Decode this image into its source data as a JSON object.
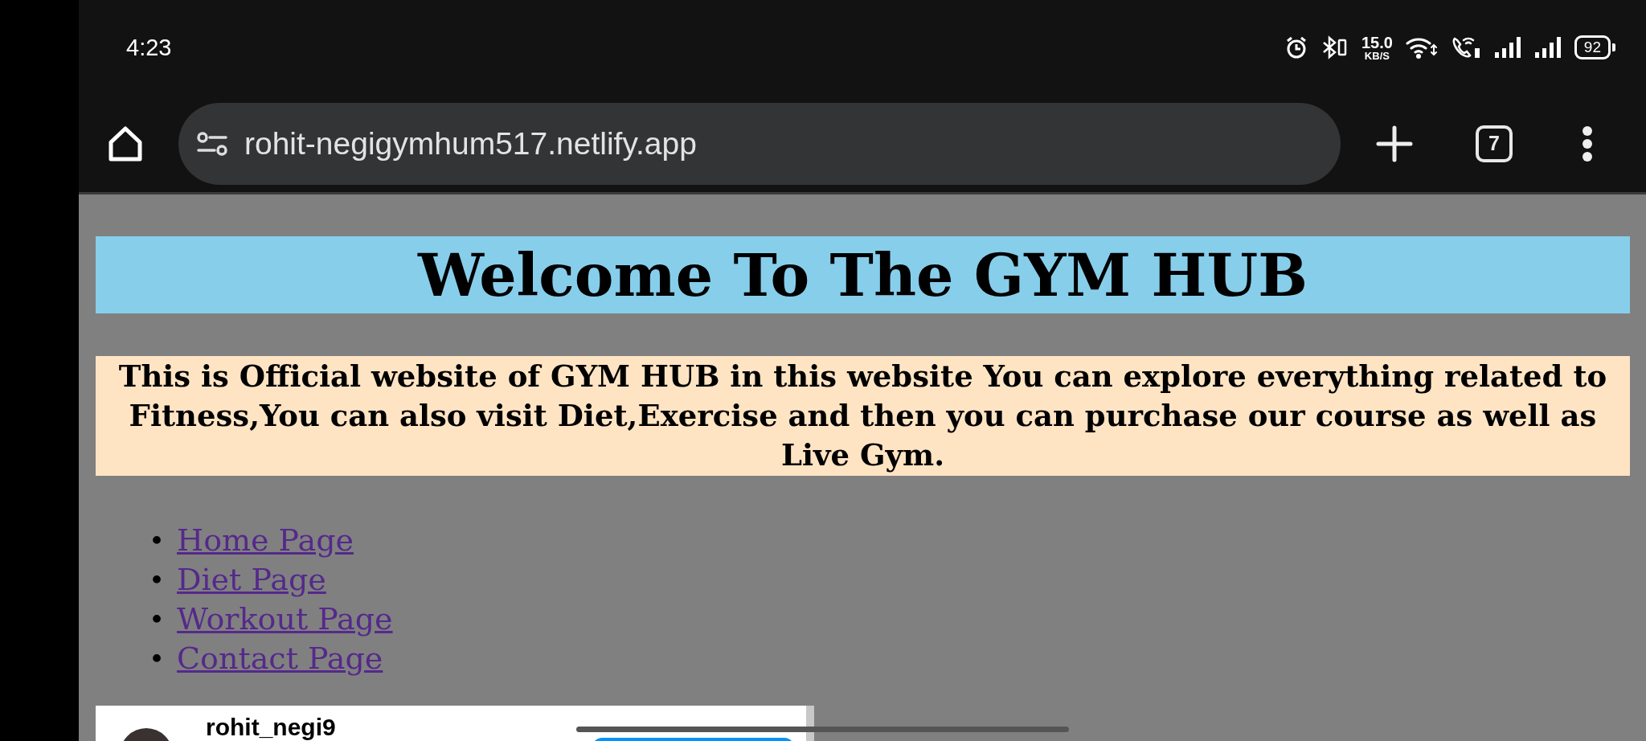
{
  "status_bar": {
    "time": "4:23",
    "speed_value": "15.0",
    "speed_unit": "KB/S",
    "battery": "92"
  },
  "browser": {
    "url": "rohit-negigymhum517.netlify.app",
    "tab_count": "7"
  },
  "page": {
    "heading": "Welcome To The GYM HUB",
    "intro": "This is Official website of GYM HUB in this website You can explore everything related to Fitness,You can also visit Diet,Exercise and then you can purchase our course as well as Live Gym.",
    "links": [
      {
        "marker": "•",
        "label": "Home Page"
      },
      {
        "marker": "•",
        "label": "Diet Page"
      },
      {
        "marker": "•",
        "label": "Workout Page"
      },
      {
        "marker": "•",
        "label": "Contact Page"
      }
    ],
    "embed": {
      "username": "rohit_negi9"
    }
  }
}
